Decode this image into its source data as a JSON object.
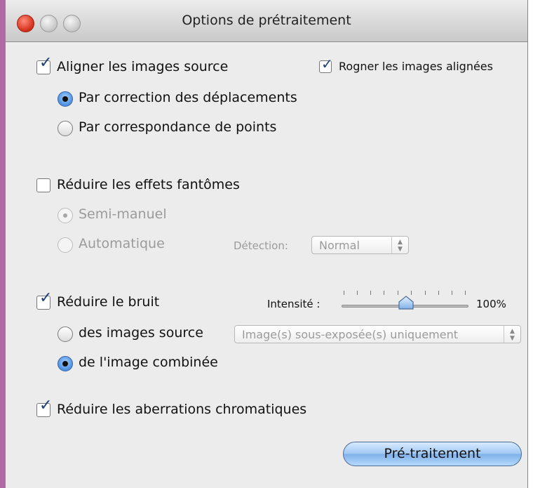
{
  "window": {
    "title": "Options de prétraitement"
  },
  "align": {
    "label": "Aligner les images source",
    "checked": true,
    "crop_label": "Rogner les images alignées",
    "crop_checked": true,
    "opt_shift": "Par correction des déplacements",
    "opt_points": "Par correspondance de points",
    "selected": "shift"
  },
  "ghost": {
    "label": "Réduire les effets fantômes",
    "checked": false,
    "opt_semi": "Semi-manuel",
    "opt_auto": "Automatique",
    "detection_label": "Détection:",
    "detection_value": "Normal"
  },
  "noise": {
    "label": "Réduire le bruit",
    "checked": true,
    "intensity_label": "Intensité :",
    "intensity_value": "100%",
    "intensity_level": 0.5,
    "opt_source": "des images source",
    "source_popup_value": "Image(s) sous-exposée(s) uniquement",
    "opt_combined": "de l'image combinée",
    "selected": "combined"
  },
  "chroma": {
    "label": "Réduire les aberrations chromatiques",
    "checked": true
  },
  "buttons": {
    "pretraitement": "Pré-traitement"
  },
  "icons": {
    "checkmark": "checkmark-icon",
    "popup_arrows": "updown-arrows-icon",
    "close": "close-icon",
    "minimize": "minimize-icon",
    "zoom": "zoom-icon"
  }
}
